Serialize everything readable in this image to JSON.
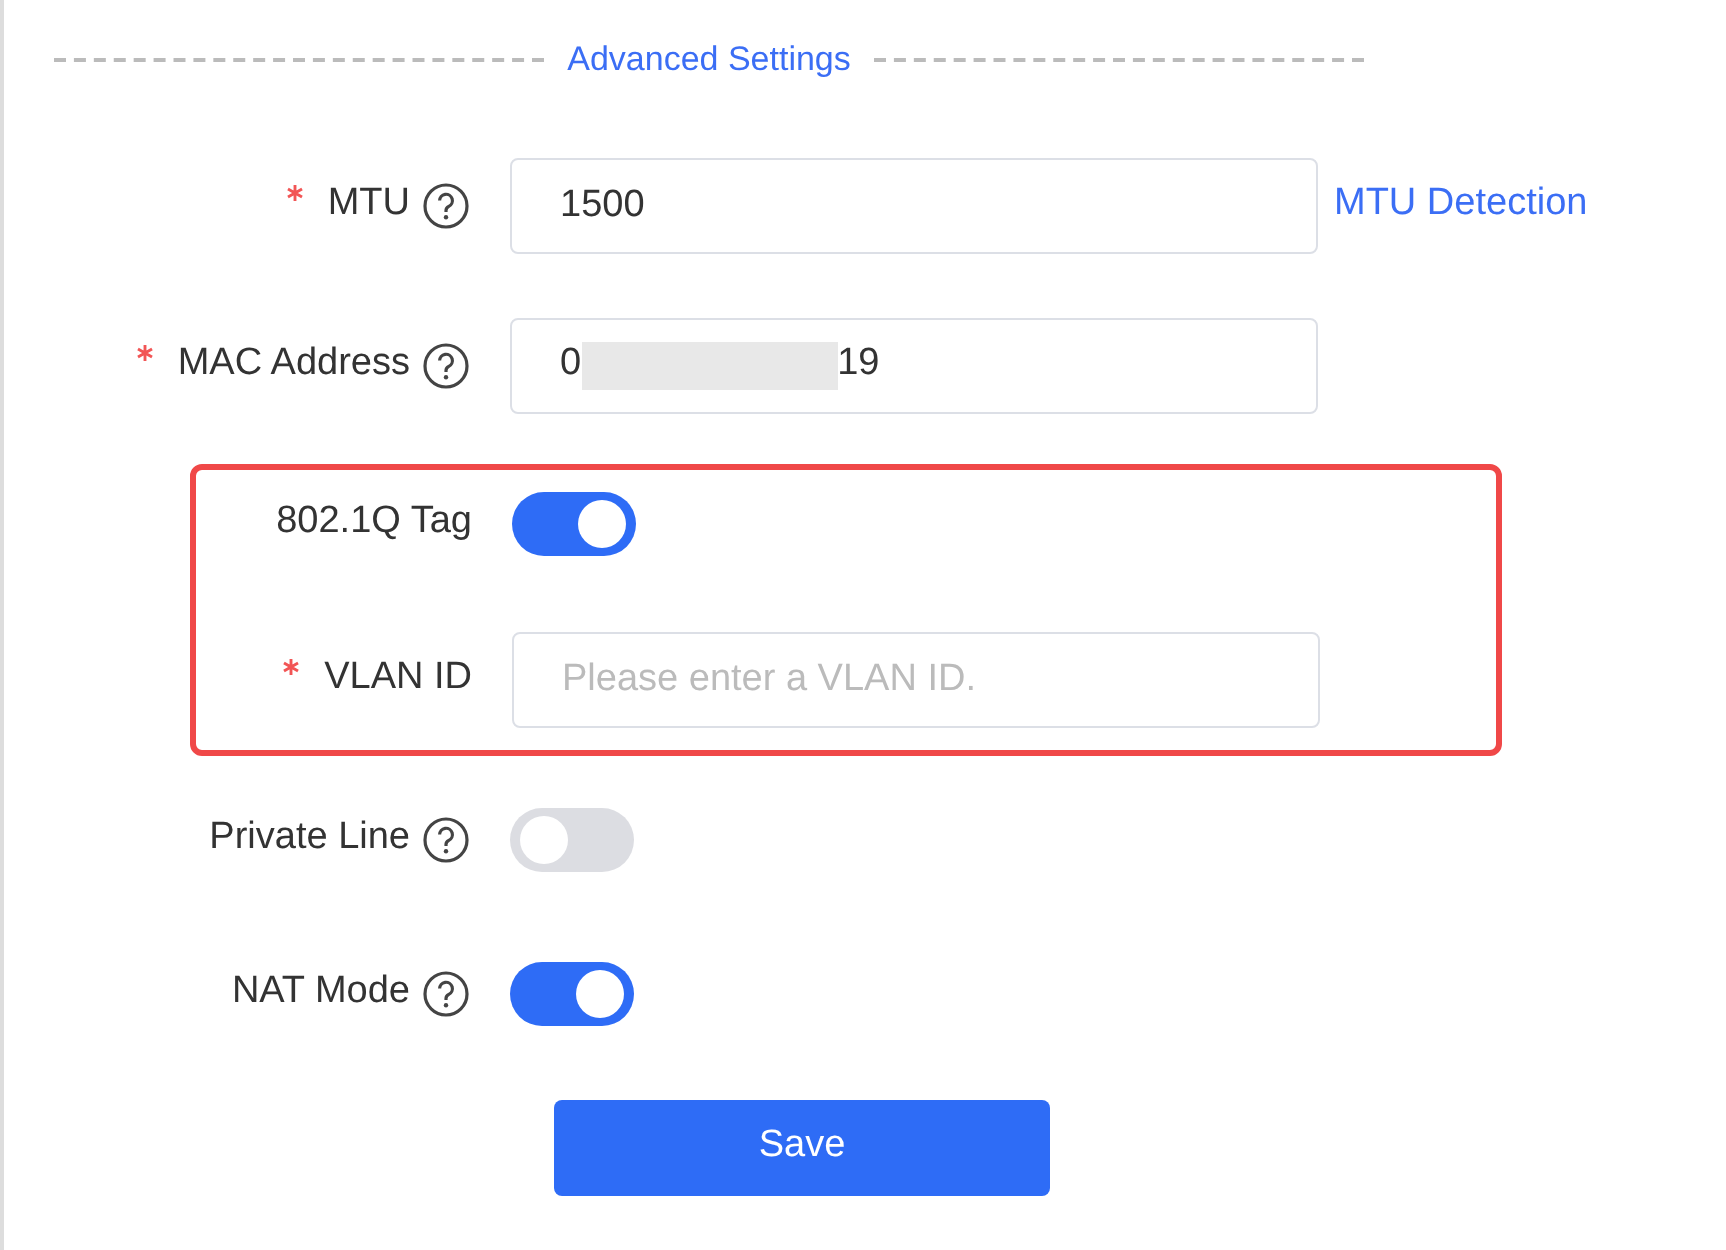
{
  "section_title": "Advanced Settings",
  "fields": [
    {
      "kind": "input",
      "label": "MTU",
      "required": true,
      "help": true,
      "value": "1500",
      "link": "MTU Detection",
      "highlighted": false
    },
    {
      "kind": "masked",
      "label": "MAC Address",
      "required": true,
      "help": true,
      "value_start": "0",
      "value_end": "19",
      "highlighted": false
    },
    {
      "kind": "switch",
      "label": "802.1Q Tag",
      "required": false,
      "help": false,
      "on": true,
      "highlighted": true
    },
    {
      "kind": "input",
      "label": "VLAN ID",
      "required": true,
      "help": false,
      "placeholder": "Please enter a VLAN ID.",
      "highlighted": true
    },
    {
      "kind": "switch",
      "label": "Private Line",
      "required": false,
      "help": true,
      "on": false,
      "highlighted": false
    },
    {
      "kind": "switch",
      "label": "NAT Mode",
      "required": false,
      "help": true,
      "on": true,
      "highlighted": false
    }
  ],
  "save_button": "Save"
}
